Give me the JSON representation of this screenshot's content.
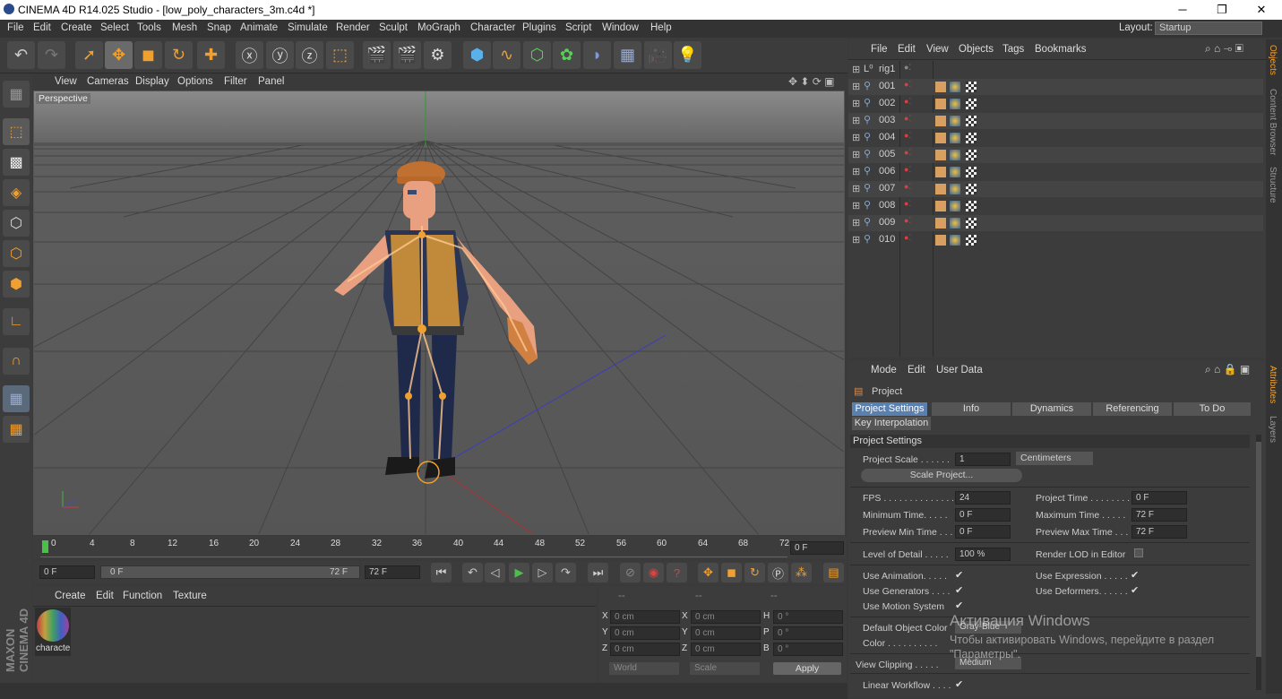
{
  "titlebar": {
    "title": "CINEMA 4D R14.025 Studio - [low_poly_characters_3m.c4d *]",
    "minimize": "─",
    "maximize": "❐",
    "close": "✕"
  },
  "menubar": {
    "items": [
      "File",
      "Edit",
      "Create",
      "Select",
      "Tools",
      "Mesh",
      "Snap",
      "Animate",
      "Simulate",
      "Render",
      "Sculpt",
      "MoGraph",
      "Character",
      "Plugins",
      "Script",
      "Window",
      "Help"
    ],
    "layout_label": "Layout:",
    "layout_value": "Startup"
  },
  "viewport": {
    "menu": [
      "View",
      "Cameras",
      "Display",
      "Options",
      "Filter",
      "Panel"
    ],
    "label": "Perspective"
  },
  "timeline": {
    "ticks": [
      "0",
      "4",
      "8",
      "12",
      "16",
      "20",
      "24",
      "28",
      "32",
      "36",
      "40",
      "44",
      "48",
      "52",
      "56",
      "60",
      "64",
      "68",
      "72"
    ],
    "current_frame": "0 F"
  },
  "transport": {
    "start": "0 F",
    "range_start": "0 F",
    "range_end": "72 F",
    "end": "72 F"
  },
  "material_manager": {
    "menu": [
      "Create",
      "Edit",
      "Function",
      "Texture"
    ],
    "material_name": "characte"
  },
  "coordinates": {
    "headers": [
      "--",
      "--",
      "--"
    ],
    "rows": [
      {
        "a": "X",
        "av": "0 cm",
        "b": "X",
        "bv": "0 cm",
        "c": "H",
        "cv": "0 °"
      },
      {
        "a": "Y",
        "av": "0 cm",
        "b": "Y",
        "bv": "0 cm",
        "c": "P",
        "cv": "0 °"
      },
      {
        "a": "Z",
        "av": "0 cm",
        "b": "Z",
        "bv": "0 cm",
        "c": "B",
        "cv": "0 °"
      }
    ],
    "world": "World",
    "scale": "Scale",
    "apply": "Apply"
  },
  "object_manager": {
    "menu": [
      "File",
      "Edit",
      "View",
      "Objects",
      "Tags",
      "Bookmarks"
    ],
    "objects": [
      "rig1",
      "001",
      "002",
      "003",
      "004",
      "005",
      "006",
      "007",
      "008",
      "009",
      "010"
    ]
  },
  "attributes": {
    "menu": [
      "Mode",
      "Edit",
      "User Data"
    ],
    "object": "Project",
    "tabs": [
      "Project Settings",
      "Info",
      "Dynamics",
      "Referencing",
      "To Do"
    ],
    "tab2": "Key Interpolation",
    "section": "Project Settings",
    "project_scale_label": "Project Scale . . . . . .",
    "project_scale": "1",
    "unit": "Centimeters",
    "scale_button": "Scale Project...",
    "fps_label": "FPS . . . . . . . . . . . . . .",
    "fps": "24",
    "project_time_label": "Project Time . . . . . . . .",
    "project_time": "0 F",
    "min_time_label": "Minimum Time. . . . .",
    "min_time": "0 F",
    "max_time_label": "Maximum Time . . . . .",
    "max_time": "72 F",
    "prev_min_label": "Preview Min Time . . .",
    "prev_min": "0 F",
    "prev_max_label": "Preview Max Time . . .",
    "prev_max": "72 F",
    "lod_label": "Level of Detail . . . . .",
    "lod": "100 %",
    "render_lod_label": "Render LOD in Editor",
    "use_anim": "Use Animation. . . . .",
    "use_expr": "Use Expression . . . . .",
    "use_gen": "Use Generators . . . .",
    "use_def": "Use Deformers. . . . . .",
    "use_motion": "Use Motion System",
    "def_color_label": "Default Object Color",
    "def_color": "Gray-Blue",
    "color_label": "Color . . . . . . . . . .",
    "view_clip_label": "View Clipping . . . . .",
    "view_clip": "Medium",
    "linear_label": "Linear Workflow . . . .",
    "check": "✔"
  },
  "watermark": {
    "line1": "Активация Windows",
    "line2": "Чтобы активировать Windows, перейдите в раздел",
    "line3": "\"Параметры\"."
  },
  "right_tabs": [
    "Objects",
    "Content Browser",
    "Structure",
    "Attributes",
    "Layers"
  ],
  "colors": {
    "accent": "#f0a030",
    "active_tab": "#5a80b0",
    "bg": "#3c3c3c"
  }
}
